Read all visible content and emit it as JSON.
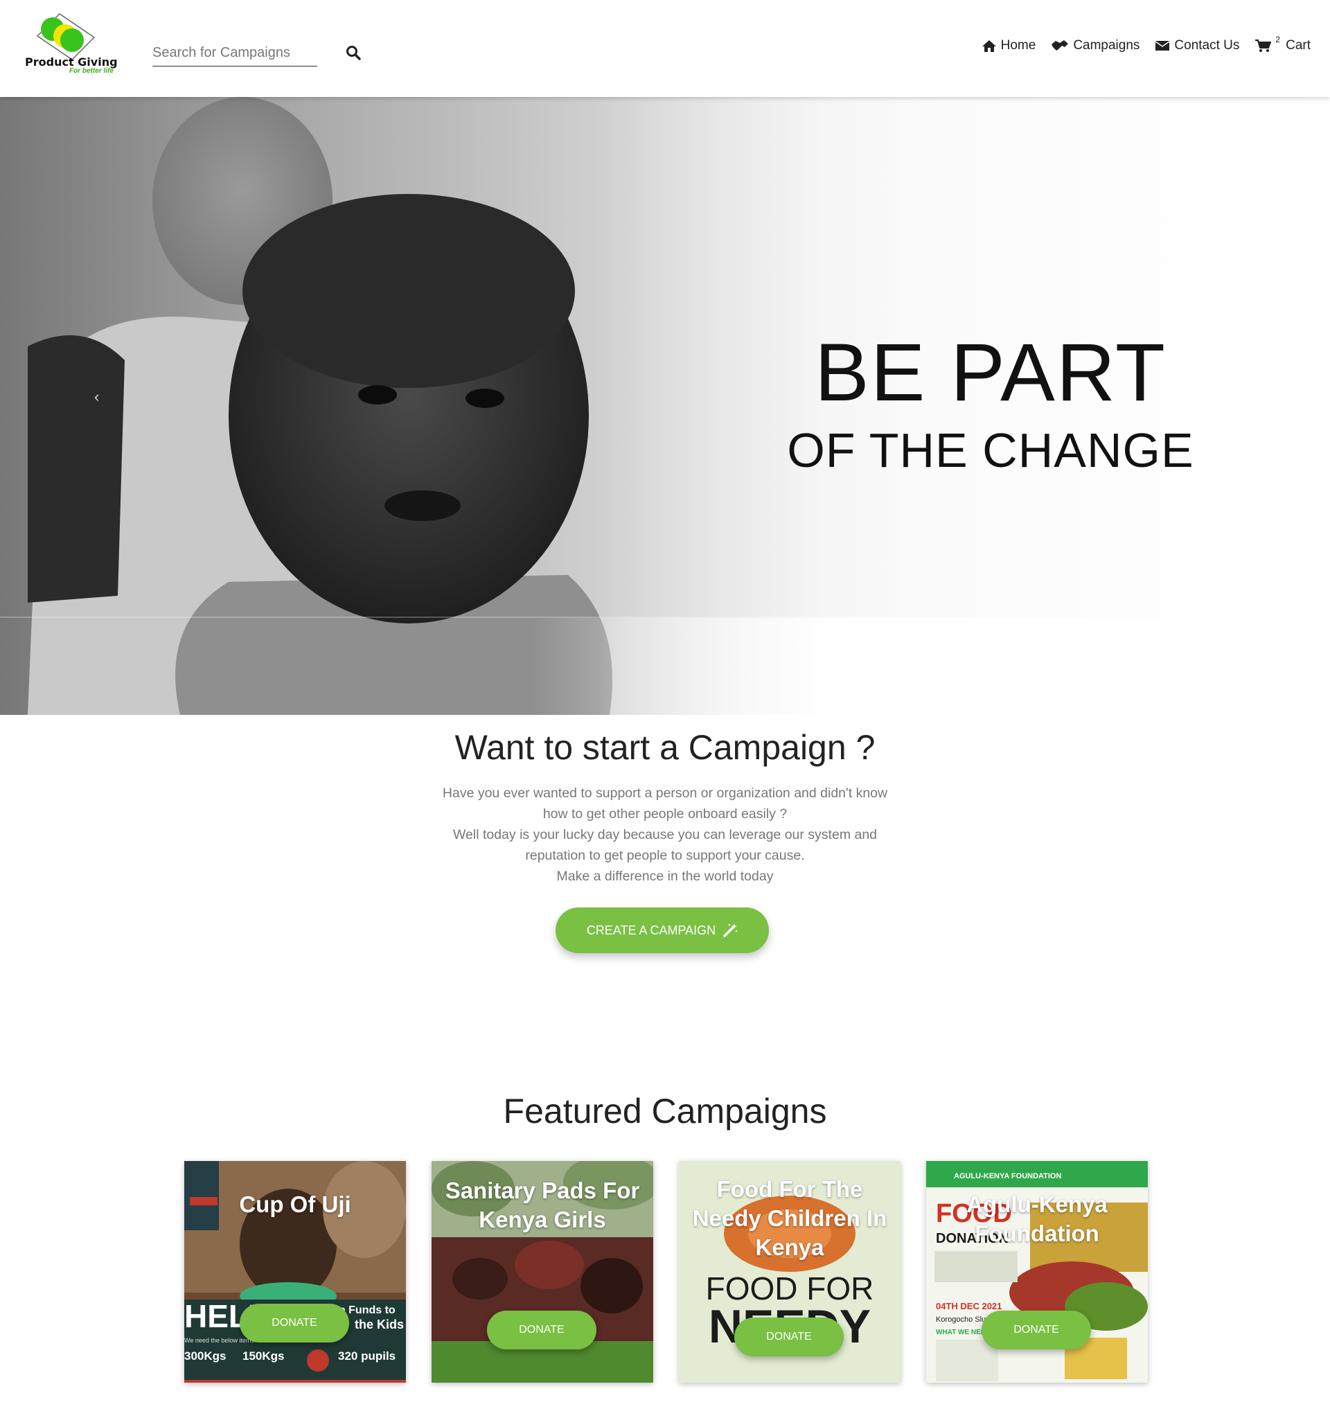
{
  "header": {
    "logo_text": "Product Giving",
    "logo_tagline": "For better life",
    "search": {
      "placeholder": "Search for Campaigns",
      "value": ""
    },
    "nav": {
      "home": "Home",
      "campaigns": "Campaigns",
      "contact": "Contact Us",
      "cart_count": "2",
      "cart": "Cart"
    }
  },
  "hero": {
    "title": "BE PART",
    "subtitle": "OF THE CHANGE",
    "prev_glyph": "‹"
  },
  "start": {
    "title": "Want to start a Campaign ?",
    "lines": [
      "Have you ever wanted to support a person or organization and didn't know",
      "how to get other people onboard easily ?",
      "Well today is your lucky day because you can leverage our system and",
      "reputation to get people to support your cause.",
      "Make a difference in the world today"
    ],
    "button": "Create a campaign"
  },
  "featured": {
    "title": "Featured Campaigns",
    "donate_label": "Donate",
    "cards": [
      {
        "title": "Cup Of Uji"
      },
      {
        "title": "Sanitary Pads For Kenya Girls"
      },
      {
        "title": "Food For The Needy Children In Kenya"
      },
      {
        "title": "Agulu-Kenya Foundation"
      }
    ]
  },
  "poster_text": {
    "cup_poster_big": "HELP US",
    "cup_poster_side": "Raise Funds to",
    "cup_poster_side2": "the Kids",
    "cup_poster_need": "We need the below items",
    "cup_item1": "300Kgs",
    "cup_item2": "150Kgs",
    "cup_item3": "320 pupils",
    "food_poster_big": "FOOD FOR",
    "food_poster_big2": "NEEDY",
    "agulu_header": "AGULU-KENYA FOUNDATION",
    "agulu_food": "FOOD",
    "agulu_donation": "DONATION",
    "agulu_date": "04TH DEC 2021",
    "agulu_place": "Korogocho Slums",
    "agulu_need": "WHAT WE NEED"
  },
  "colors": {
    "accent": "#79c043",
    "logo_green": "#3cb01a",
    "logo_yellow": "#f3e500",
    "card_dark": "#1f3a36"
  }
}
